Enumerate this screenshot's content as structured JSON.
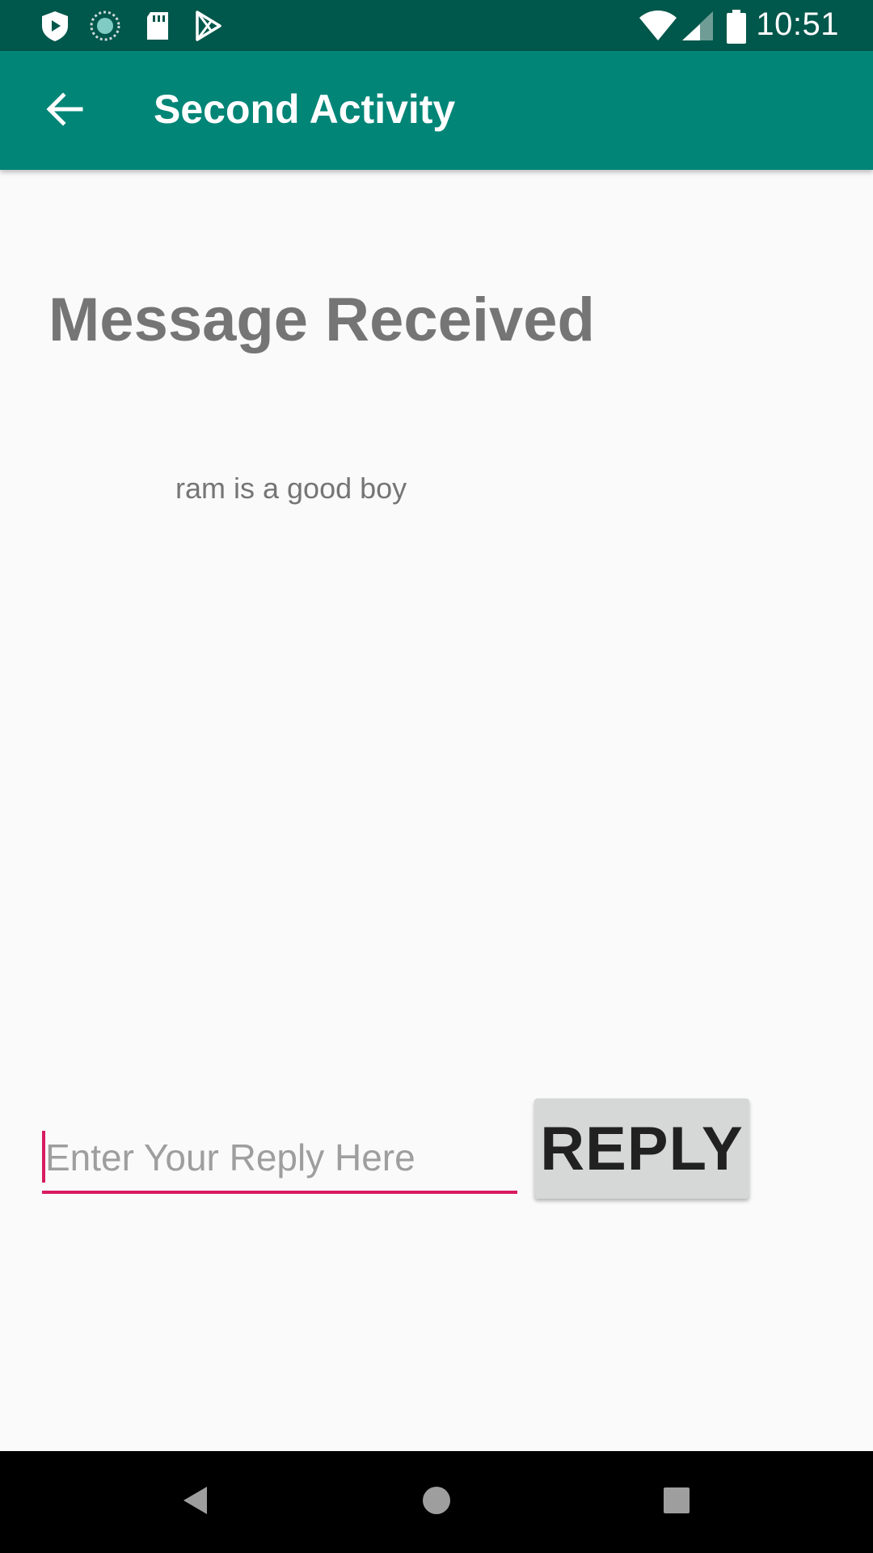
{
  "status_bar": {
    "time": "10:51",
    "left_icons": [
      "shield-icon",
      "sync-icon",
      "sd-card-icon",
      "play-store-icon"
    ],
    "right_icons": [
      "wifi-icon",
      "signal-icon",
      "battery-icon"
    ],
    "background": "#00574b"
  },
  "app_bar": {
    "title": "Second Activity",
    "back_icon": "arrow-back-icon",
    "background": "#008577"
  },
  "main": {
    "heading": "Message Received",
    "message": "ram is a good boy",
    "reply_input": {
      "placeholder": "Enter Your Reply Here",
      "value": "",
      "accent": "#d81b60"
    },
    "reply_button_label": "REPLY"
  },
  "nav_bar": {
    "buttons": [
      "back-nav-icon",
      "home-nav-icon",
      "recents-nav-icon"
    ]
  }
}
